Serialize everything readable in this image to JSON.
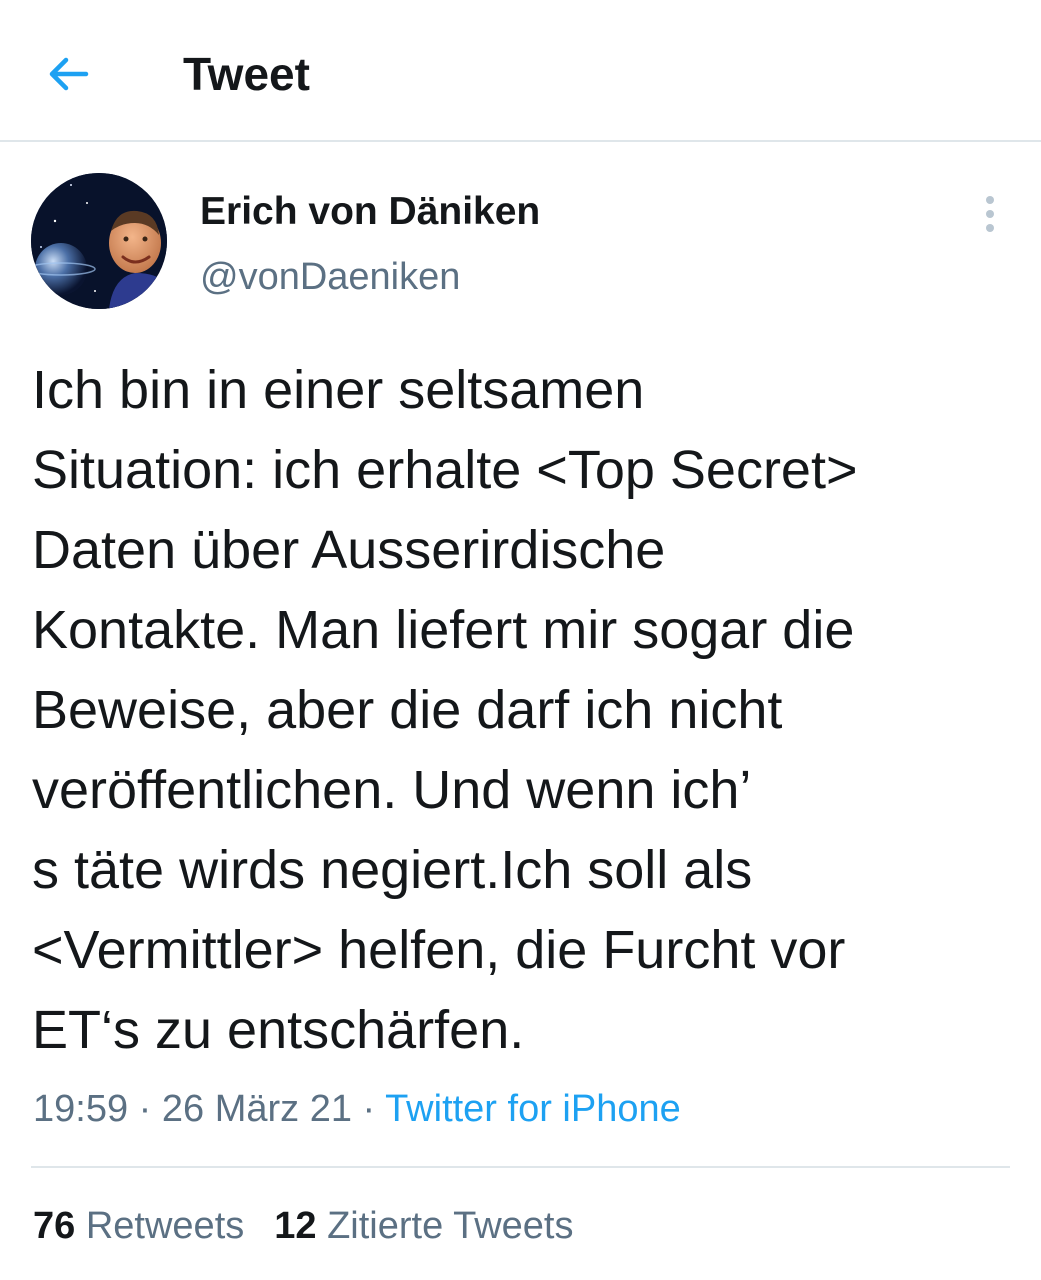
{
  "header": {
    "title": "Tweet",
    "back_icon": "arrow-left-icon",
    "accent_color": "#1da1f2"
  },
  "author": {
    "display_name": "Erich von Däniken",
    "handle": "@vonDaeniken",
    "avatar_icon": "avatar-photo"
  },
  "more_icon": "more-vertical-icon",
  "tweet": {
    "lines": [
      "Ich bin in einer seltsamen",
      "Situation: ich erhalte <Top Secret>",
      "Daten über Ausserirdische",
      "Kontakte. Man liefert mir sogar die",
      "Beweise, aber die darf ich nicht",
      "veröffentlichen. Und wenn ich’",
      "s täte wirds negiert.Ich soll als",
      "<Vermittler> helfen, die Furcht vor",
      "ET‘s zu entschärfen."
    ]
  },
  "meta": {
    "time": "19:59",
    "separator": " · ",
    "date": "26 März 21",
    "source": "Twitter for iPhone"
  },
  "stats": {
    "retweets_count": "76",
    "retweets_label": "Retweets",
    "quotes_count": "12",
    "quotes_label": "Zitierte Tweets"
  },
  "colors": {
    "text": "#14171a",
    "secondary": "#5b7083",
    "link": "#1da1f2",
    "divider": "#dfe6ea"
  }
}
